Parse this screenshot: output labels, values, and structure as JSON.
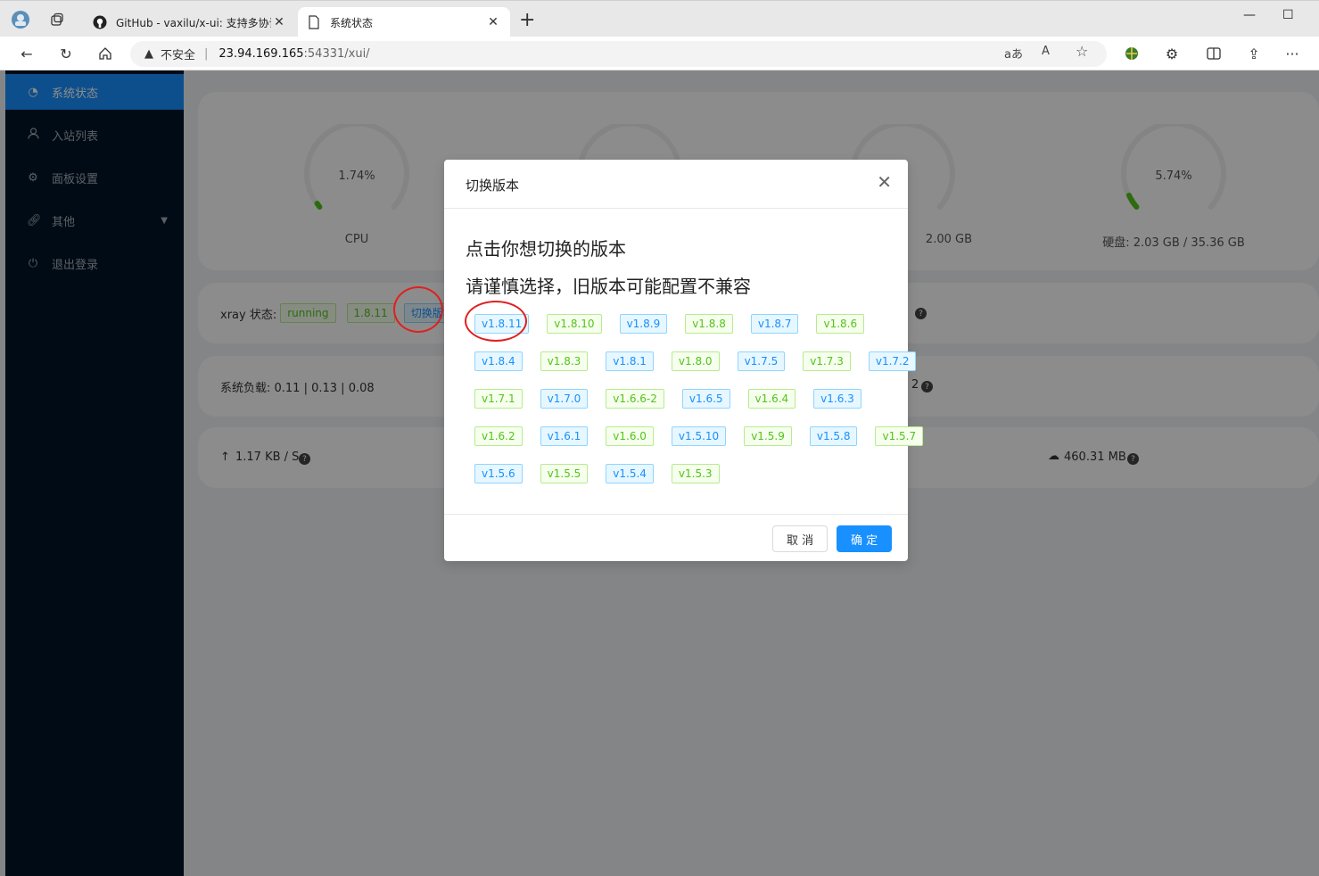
{
  "browser": {
    "tabs": [
      {
        "title": "GitHub - vaxilu/x-ui: 支持多协议多",
        "active": false
      },
      {
        "title": "系统状态",
        "active": true
      }
    ],
    "address": {
      "security_label": "不安全",
      "host": "23.94.169.165",
      "path": ":54331/xui/"
    }
  },
  "sidebar": {
    "items": [
      {
        "label": "系统状态",
        "icon": "dashboard-icon",
        "selected": true
      },
      {
        "label": "入站列表",
        "icon": "user-icon",
        "selected": false
      },
      {
        "label": "面板设置",
        "icon": "settings-icon",
        "selected": false
      },
      {
        "label": "其他",
        "icon": "link-icon",
        "selected": false
      },
      {
        "label": "退出登录",
        "icon": "logout-icon",
        "selected": false
      }
    ]
  },
  "status": {
    "cpu_percent": "1.74%",
    "cpu_label": "CPU",
    "mem_partial_label": "2.00 GB",
    "disk_percent": "5.74%",
    "disk_label": "硬盘: 2.03 GB / 35.36 GB",
    "xray_label": "xray 状态:",
    "xray_state": "running",
    "xray_version": "1.8.11",
    "switch_version": "切换版本",
    "load_label": "系统负载: 0.11 | 0.13 | 0.08",
    "load_right_partial": "2",
    "upload_speed": "1.17 KB / S",
    "download_total": "460.31 MB"
  },
  "modal": {
    "title": "切换版本",
    "line1": "点击你想切换的版本",
    "line2": "请谨慎选择，旧版本可能配置不兼容",
    "versions": [
      [
        "v1.8.11",
        "v1.8.10",
        "v1.8.9",
        "v1.8.8",
        "v1.8.7",
        "v1.8.6"
      ],
      [
        "v1.8.4",
        "v1.8.3",
        "v1.8.1",
        "v1.8.0",
        "v1.7.5",
        "v1.7.3",
        "v1.7.2"
      ],
      [
        "v1.7.1",
        "v1.7.0",
        "v1.6.6-2",
        "v1.6.5",
        "v1.6.4",
        "v1.6.3"
      ],
      [
        "v1.6.2",
        "v1.6.1",
        "v1.6.0",
        "v1.5.10",
        "v1.5.9",
        "v1.5.8",
        "v1.5.7"
      ],
      [
        "v1.5.6",
        "v1.5.5",
        "v1.5.4",
        "v1.5.3"
      ]
    ],
    "cancel_label": "取 消",
    "ok_label": "确 定"
  },
  "colors": {
    "accent": "#1890ff",
    "sider_bg": "#001529",
    "tag_green": "#52c41a",
    "tag_blue": "#1890ff",
    "annotation_red": "#e02020"
  }
}
